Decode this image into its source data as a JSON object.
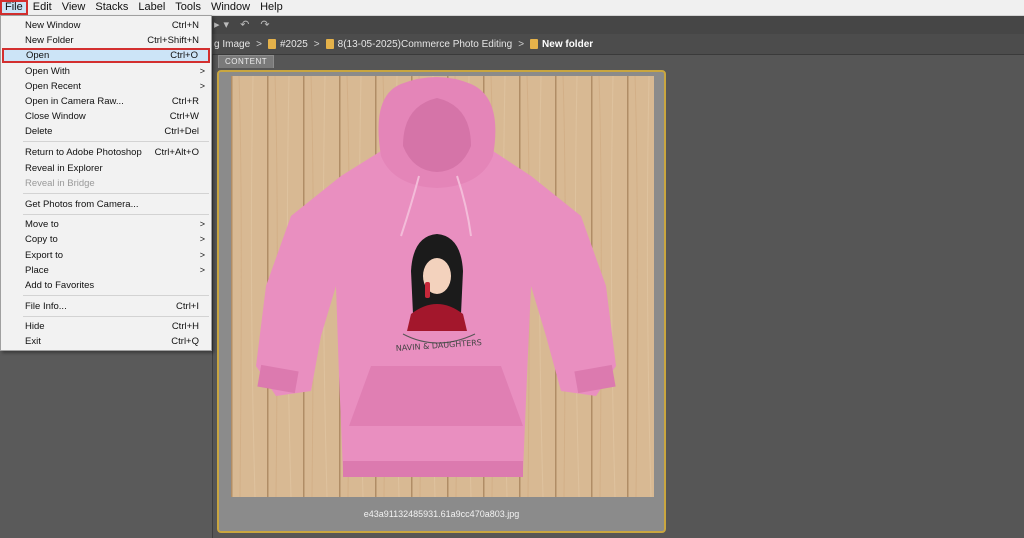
{
  "menubar": {
    "items": [
      "File",
      "Edit",
      "View",
      "Stacks",
      "Label",
      "Tools",
      "Window",
      "Help"
    ]
  },
  "pathbar": {
    "crumbs": [
      "g Image",
      "#2025",
      "8(13-05-2025)Commerce Photo Editing",
      "New folder"
    ]
  },
  "content_tab": "CONTENT",
  "file_menu": {
    "items": [
      {
        "label": "New Window",
        "shortcut": "Ctrl+N"
      },
      {
        "label": "New Folder",
        "shortcut": "Ctrl+Shift+N"
      },
      {
        "label": "Open",
        "shortcut": "Ctrl+O"
      },
      {
        "label": "Open With",
        "shortcut": ""
      },
      {
        "label": "Open Recent",
        "shortcut": ""
      },
      {
        "label": "Open in Camera Raw...",
        "shortcut": "Ctrl+R"
      },
      {
        "label": "Close Window",
        "shortcut": "Ctrl+W"
      },
      {
        "label": "Delete",
        "shortcut": "Ctrl+Del"
      },
      {
        "label": "Return to Adobe Photoshop",
        "shortcut": "Ctrl+Alt+O"
      },
      {
        "label": "Reveal in Explorer",
        "shortcut": ""
      },
      {
        "label": "Reveal in Bridge",
        "shortcut": ""
      },
      {
        "label": "Get Photos from Camera...",
        "shortcut": ""
      },
      {
        "label": "Move to",
        "shortcut": ""
      },
      {
        "label": "Copy to",
        "shortcut": ""
      },
      {
        "label": "Export to",
        "shortcut": ""
      },
      {
        "label": "Place",
        "shortcut": ""
      },
      {
        "label": "Add to Favorites",
        "shortcut": ""
      },
      {
        "label": "File Info...",
        "shortcut": "Ctrl+I"
      },
      {
        "label": "Hide",
        "shortcut": "Ctrl+H"
      },
      {
        "label": "Exit",
        "shortcut": "Ctrl+Q"
      }
    ]
  },
  "thumbnail": {
    "filename": "e43a91132485931.61a9cc470a803.jpg",
    "print_text": "NAVIN & DAUGHTERS"
  },
  "colors": {
    "selection_outline": "#d32f2f",
    "highlight": "#cce4f7",
    "thumb_border": "#c9a640",
    "hoodie": "#e98fc0"
  }
}
